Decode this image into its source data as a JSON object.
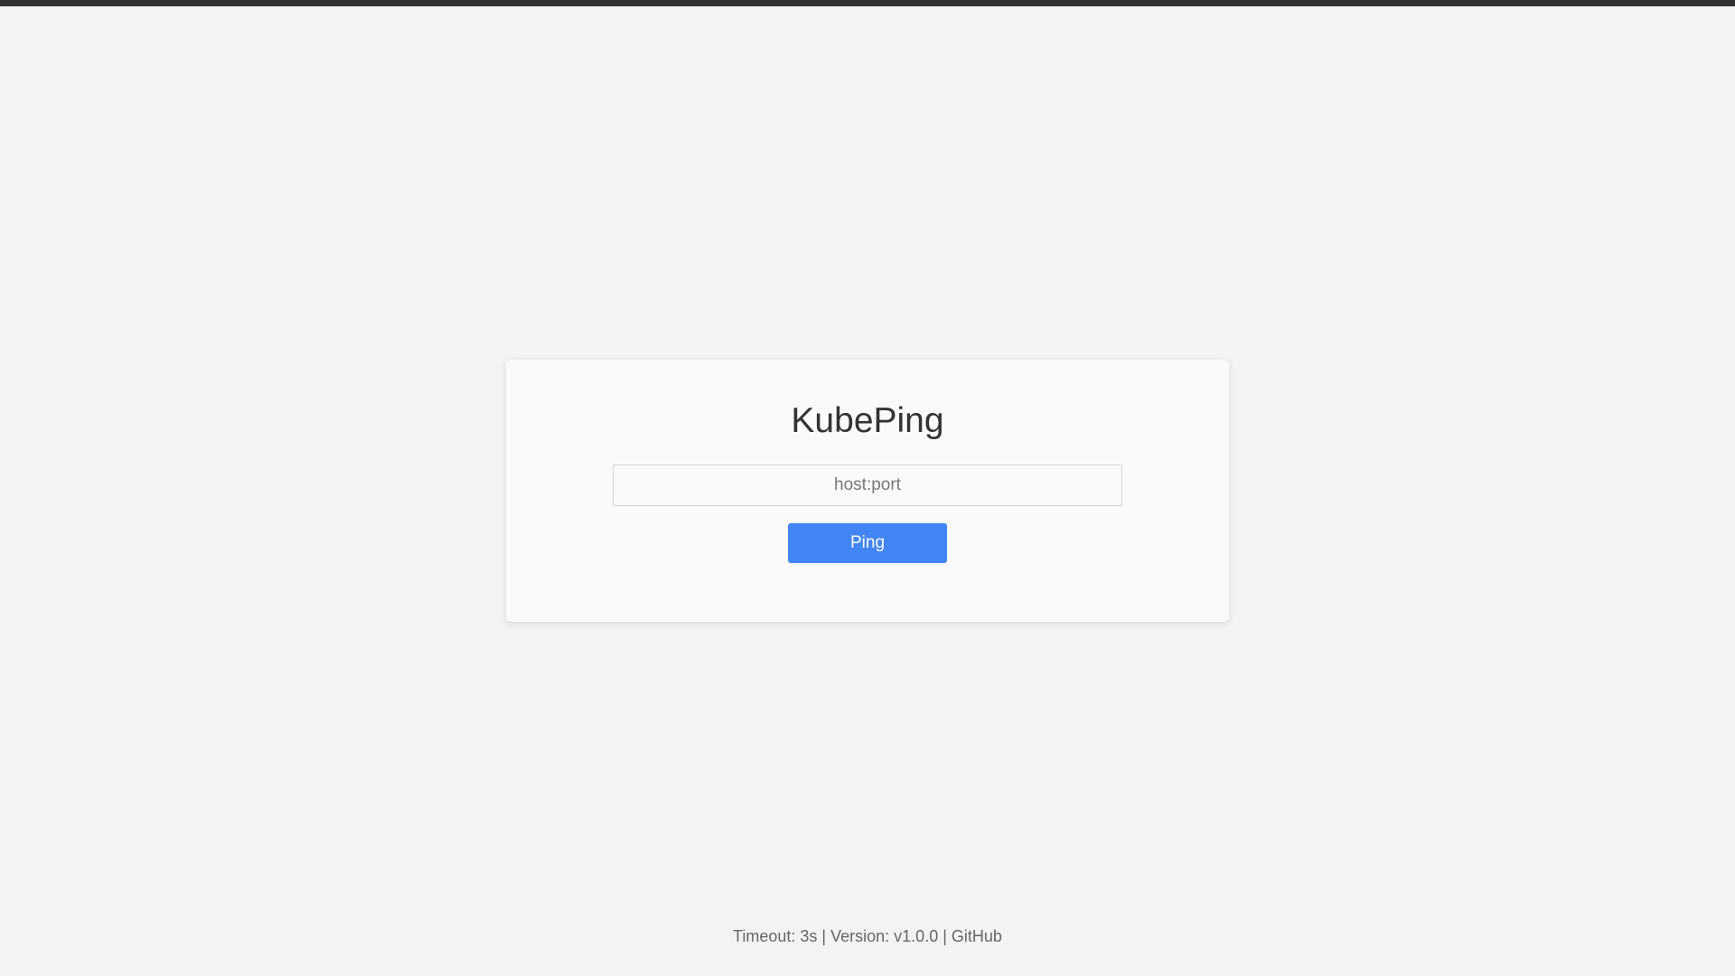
{
  "app": {
    "title": "KubePing"
  },
  "form": {
    "host_placeholder": "host:port",
    "host_value": "",
    "ping_label": "Ping"
  },
  "footer": {
    "timeout_text": "Timeout: 3s",
    "separator": "|",
    "version_text": "Version: v1.0.0",
    "github_label": "GitHub"
  },
  "colors": {
    "background": "#f3f3f1",
    "card": "#fafaf9",
    "accent": "#4285f4",
    "top_bar": "#333333"
  }
}
